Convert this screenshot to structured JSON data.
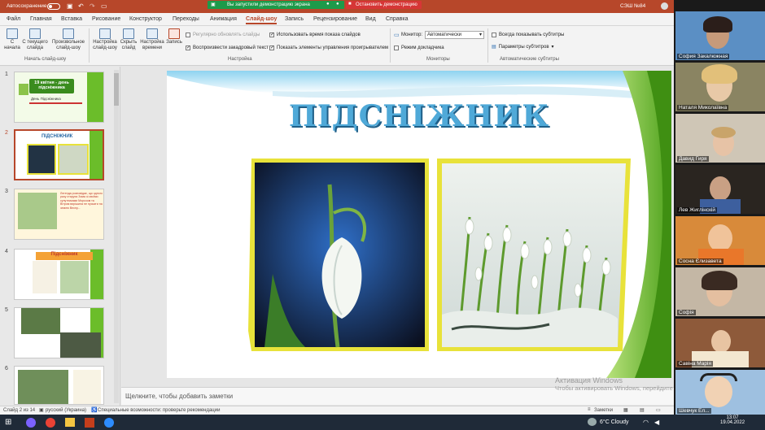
{
  "titlebar": {
    "autosave": "Автосохранение",
    "app_right": "СЭШ №84"
  },
  "sharing": {
    "notice": "Вы запустили демонстрацию экрана",
    "stop": "Остановить демонстрацию"
  },
  "tabs": [
    "Файл",
    "Главная",
    "Вставка",
    "Рисование",
    "Конструктор",
    "Переходы",
    "Анимация",
    "Слайд-шоу",
    "Запись",
    "Рецензирование",
    "Вид",
    "Справка"
  ],
  "ribbon": {
    "btn_from_start": "С начала",
    "btn_current": "С текущего слайда",
    "btn_custom": "Произвольное слайд-шоу",
    "btn_setup": "Настройка слайд-шоу",
    "btn_hide": "Скрыть слайд",
    "btn_timings": "Настройка времени",
    "btn_record": "Запись",
    "chk_update": "Регулярно обновлять слайды",
    "chk_narration": "Воспроизвести закадровый текст",
    "chk_timings": "Использовать время показа слайдов",
    "chk_controls": "Показать элементы управления проигрывателем",
    "monitor_label": "Монитор:",
    "monitor_value": "Автоматически",
    "presenter_view": "Режим докладчика",
    "always_subtitles": "Всегда показывать субтитры",
    "subtitle_settings": "Параметры субтитров",
    "group_start": "Начать слайд-шоу",
    "group_setup": "Настройка",
    "group_monitors": "Мониторы",
    "group_captions": "Автоматические субтитры"
  },
  "slides": [
    {
      "num": "1",
      "title": "19 квітня - день підсніжника",
      "sub": "День Підсніжника"
    },
    {
      "num": "2",
      "title": "ПІДСНІЖНИК"
    },
    {
      "num": "3",
      "text": "Легенда розповідає, що одного разу старуха Зима зі своїми супутниками Морозом та Вітром вирішила не пускати на землю Весну..."
    },
    {
      "num": "4",
      "title": "Підсніжник"
    },
    {
      "num": "5"
    },
    {
      "num": "6"
    }
  ],
  "main_slide": {
    "title": "ПІДСНІЖНИК"
  },
  "notes_placeholder": "Щелкните, чтобы добавить заметки",
  "watermark": {
    "line1": "Активация Windows",
    "line2": "Чтобы активировать Windows, перейдите в раздел"
  },
  "status": {
    "slide": "Слайд 2 из 14",
    "lang": "русский (Украина)",
    "access": "Специальные возможности: проверьте рекомендации",
    "notes_btn": "Заметки"
  },
  "participants": [
    {
      "name": "София Закалюжная"
    },
    {
      "name": "Наталя Миколаївна"
    },
    {
      "name": "Давид Гиря"
    },
    {
      "name": "Лев Жиглінскій"
    },
    {
      "name": "Сосна Єлизавета"
    },
    {
      "name": "Софія"
    },
    {
      "name": "Савіна Марія"
    },
    {
      "name": "Шевчук Ел..."
    }
  ],
  "taskbar": {
    "weather": "6°C Cloudy",
    "date": "19.04.2022",
    "time": "13:07"
  },
  "colors": {
    "accent": "#b7472a",
    "share": "#1d9a4a",
    "stop": "#d63636",
    "slide_green": "#6bbd2a",
    "frame_yellow": "#e8e23a"
  }
}
